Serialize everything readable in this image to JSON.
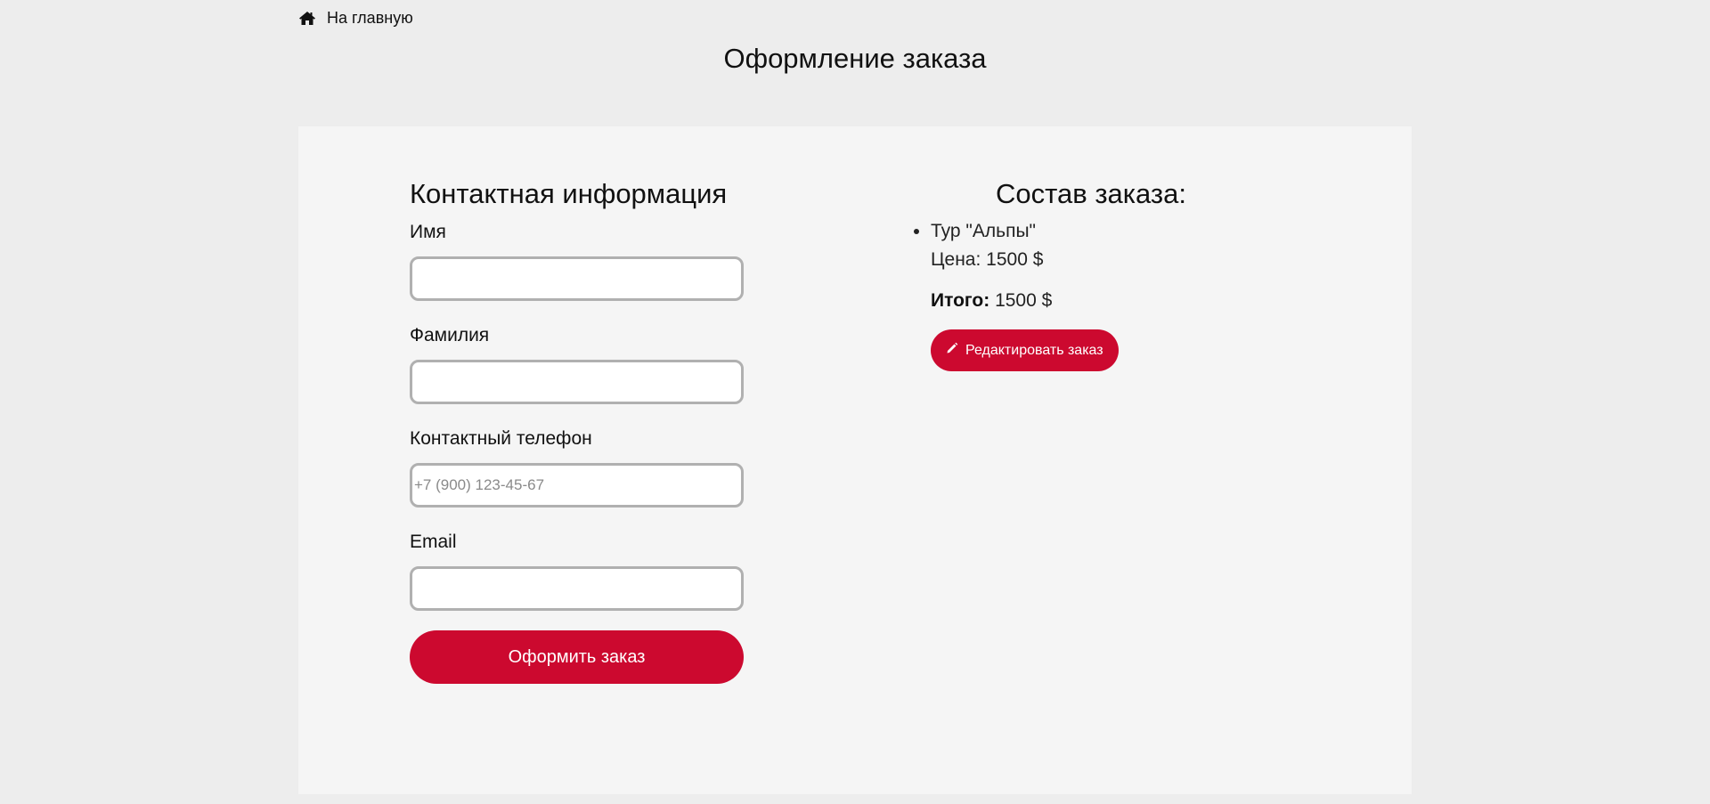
{
  "nav": {
    "home_icon": "home-icon",
    "home_label": "На главную"
  },
  "page": {
    "title": "Оформление заказа"
  },
  "contact": {
    "title": "Контактная информация",
    "fields": {
      "first_name": {
        "label": "Имя",
        "value": "",
        "placeholder": ""
      },
      "last_name": {
        "label": "Фамилия",
        "value": "",
        "placeholder": ""
      },
      "phone": {
        "label": "Контактный телефон",
        "value": "",
        "placeholder": "+7 (900) 123-45-67"
      },
      "email": {
        "label": "Email",
        "value": "",
        "placeholder": ""
      }
    },
    "submit_label": "Оформить заказ"
  },
  "order": {
    "title": "Состав заказа:",
    "items": [
      {
        "name": "Тур \"Альпы\"",
        "price": "Цена: 1500 $"
      }
    ],
    "total_label": "Итого:",
    "total_value": "1500 $",
    "edit_icon": "pencil-icon",
    "edit_label": "Редактировать заказ"
  },
  "colors": {
    "background": "#ededed",
    "panel": "#f5f5f5",
    "accent": "#cc092f",
    "input_border": "#b0b0b0"
  }
}
